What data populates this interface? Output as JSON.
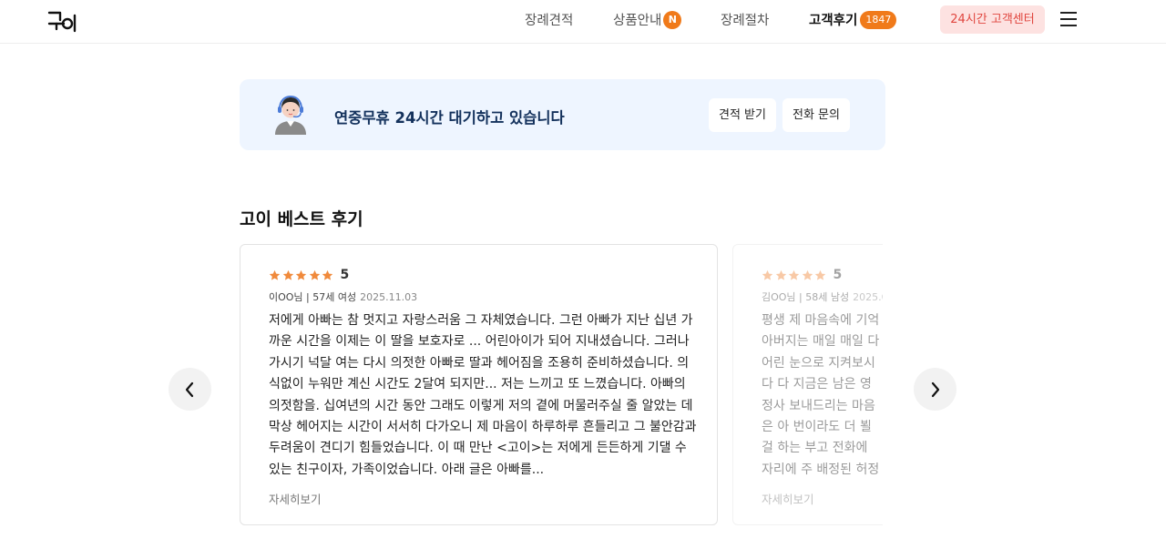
{
  "header": {
    "logo_alt": "고이",
    "nav": [
      {
        "label": "장례견적",
        "badge": ""
      },
      {
        "label": "상품안내",
        "badge": "N"
      },
      {
        "label": "장례절차",
        "badge": ""
      },
      {
        "label": "고객후기",
        "badge": "1847"
      }
    ],
    "cs_button": "24시간 고객센터"
  },
  "banner": {
    "text": "연중무휴 24시간 대기하고 있습니다",
    "quote_button": "견적 받기",
    "call_button": "전화 문의"
  },
  "section": {
    "title": "고이 베스트 후기"
  },
  "reviews": [
    {
      "rating": "5",
      "author": "이OO님 | 57세 여성",
      "date": "2025.11.03",
      "text": "저에게 아빠는 참 멋지고 자랑스러움 그 자체였습니다. 그런 아빠가 지난 십년 가까운 시간을 이제는 이 딸을 보호자로 ... 어린아이가 되어 지내셨습니다. 그러나 가시기 넉달 여는 다시 의젓한 아빠로 딸과 헤어짐을 조용히 준비하셨습니다. 의식없이 누워만 계신 시간도 2달여 되지만... 저는 느끼고 또 느꼈습니다. 아빠의 의젓함을. 십여년의 시간 동안 그래도 이렇게 저의 곁에 머물러주실 줄 알았는 데 막상 헤어지는 시간이 서서히 다가오니 제 마음이 하루하루 흔들리고 그 불안감과 두려움이 견디기 힘들었습니다. 이 때 만난 <고이>는 저에게 든든하게 기댈 수 있는 친구이자, 가족이었습니다. 아래 글은 아빠를...",
      "more": "자세히보기"
    },
    {
      "rating": "5",
      "author": "김OO님 | 58세 남성",
      "date": "2025.0",
      "text": "평생 제 마음속에 기억 아버지는 매일 매일 다 어린 눈으로 지켜보시다 다 지금은 남은 영정사 보내드리는 마음은 아 번이라도 더 뵐걸 하는 부고 전화에 자리에 주 배정된 허정원팀장님의",
      "more": "자세히보기"
    }
  ],
  "colors": {
    "accent": "#f07a1a",
    "star": "#f08a3c",
    "banner_bg": "#eef5ff",
    "cs_bg": "#fde2e1",
    "cs_text": "#e0463f"
  },
  "icons": {
    "menu": "hamburger-menu-icon",
    "prev": "chevron-left-icon",
    "next": "chevron-right-icon",
    "agent": "headset-agent-icon",
    "star": "star-icon"
  }
}
